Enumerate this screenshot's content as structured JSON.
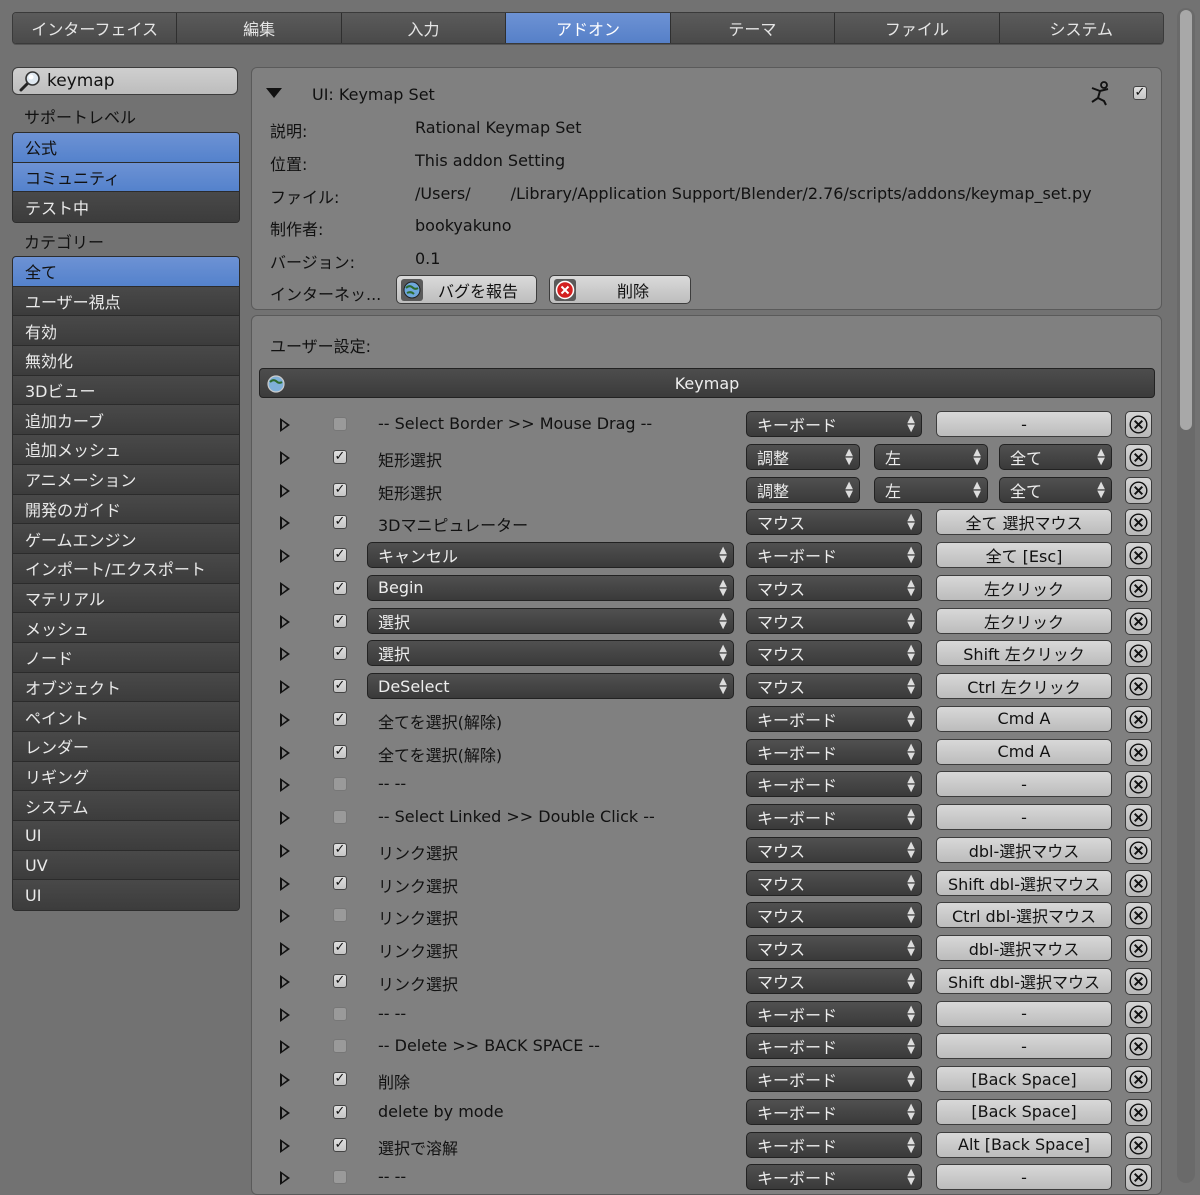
{
  "tabs": [
    "インターフェイス",
    "編集",
    "入力",
    "アドオン",
    "テーマ",
    "ファイル",
    "システム"
  ],
  "active_tab": 3,
  "search": {
    "value": "keymap"
  },
  "sidebar": {
    "support_label": "サポートレベル",
    "support_items": [
      "公式",
      "コミュニティ",
      "テスト中"
    ],
    "category_label": "カテゴリー",
    "category_items": [
      "全て",
      "ユーザー視点",
      "有効",
      "無効化",
      "3Dビュー",
      "追加カーブ",
      "追加メッシュ",
      "アニメーション",
      "開発のガイド",
      "ゲームエンジン",
      "インポート/エクスポート",
      "マテリアル",
      "メッシュ",
      "ノード",
      "オブジェクト",
      "ペイント",
      "レンダー",
      "リギング",
      "システム",
      "UI",
      "UV",
      "UI"
    ]
  },
  "addon": {
    "title": "UI: Keymap Set",
    "enabled": true,
    "fields": [
      {
        "label": "説明:",
        "value": "Rational Keymap Set"
      },
      {
        "label": "位置:",
        "value": "This addon Setting"
      },
      {
        "label": "ファイル:",
        "value": "/Users/     /Library/Application Support/Blender/2.76/scripts/addons/keymap_set.py"
      },
      {
        "label": "制作者:",
        "value": "bookyakuno"
      },
      {
        "label": "バージョン:",
        "value": "0.1"
      }
    ],
    "internet_label": "インターネッ...",
    "report_bug": "バグを報告",
    "remove": "削除"
  },
  "prefs": {
    "label": "ユーザー設定:",
    "keymap_header": "Keymap"
  },
  "colors": {
    "accent": "#5b86cf",
    "panel": "#808080",
    "dark_button": "#444444"
  },
  "keymap_rows": [
    {
      "checked": false,
      "name": "-- Select Border >> Mouse Drag --",
      "type": "キーボード",
      "key": "-"
    },
    {
      "checked": true,
      "name": "矩形選択",
      "type": "調整",
      "dir": "左",
      "val": "全て",
      "tweak": true
    },
    {
      "checked": true,
      "name": "矩形選択",
      "type": "調整",
      "dir": "左",
      "val": "全て",
      "tweak": true
    },
    {
      "checked": true,
      "name": "3Dマニピュレーター",
      "type": "マウス",
      "key": "全て 選択マウス"
    },
    {
      "checked": true,
      "name": "キャンセル",
      "type": "キーボード",
      "key": "全て [Esc]",
      "dropdown": true
    },
    {
      "checked": true,
      "name": "Begin",
      "type": "マウス",
      "key": "左クリック",
      "dropdown": true
    },
    {
      "checked": true,
      "name": "選択",
      "type": "マウス",
      "key": "左クリック",
      "dropdown": true
    },
    {
      "checked": true,
      "name": "選択",
      "type": "マウス",
      "key": "Shift 左クリック",
      "dropdown": true
    },
    {
      "checked": true,
      "name": "DeSelect",
      "type": "マウス",
      "key": "Ctrl 左クリック",
      "dropdown": true
    },
    {
      "checked": true,
      "name": "全てを選択(解除)",
      "type": "キーボード",
      "key": "Cmd A"
    },
    {
      "checked": true,
      "name": "全てを選択(解除)",
      "type": "キーボード",
      "key": "Cmd A"
    },
    {
      "checked": false,
      "name": "--  --",
      "type": "キーボード",
      "key": "-"
    },
    {
      "checked": false,
      "name": "-- Select Linked >> Double Click --",
      "type": "キーボード",
      "key": "-"
    },
    {
      "checked": true,
      "name": "リンク選択",
      "type": "マウス",
      "key": "dbl-選択マウス"
    },
    {
      "checked": true,
      "name": "リンク選択",
      "type": "マウス",
      "key": "Shift dbl-選択マウス"
    },
    {
      "checked": false,
      "name": "リンク選択",
      "type": "マウス",
      "key": "Ctrl dbl-選択マウス"
    },
    {
      "checked": true,
      "name": "リンク選択",
      "type": "マウス",
      "key": "dbl-選択マウス"
    },
    {
      "checked": true,
      "name": "リンク選択",
      "type": "マウス",
      "key": "Shift dbl-選択マウス"
    },
    {
      "checked": false,
      "name": "--  --",
      "type": "キーボード",
      "key": "-"
    },
    {
      "checked": false,
      "name": "-- Delete >> BACK SPACE  --",
      "type": "キーボード",
      "key": "-"
    },
    {
      "checked": true,
      "name": "削除",
      "type": "キーボード",
      "key": "[Back Space]"
    },
    {
      "checked": true,
      "name": "delete by mode",
      "type": "キーボード",
      "key": "[Back Space]"
    },
    {
      "checked": true,
      "name": "選択で溶解",
      "type": "キーボード",
      "key": "Alt [Back Space]"
    },
    {
      "checked": false,
      "name": "--  --",
      "type": "キーボード",
      "key": "-"
    }
  ]
}
